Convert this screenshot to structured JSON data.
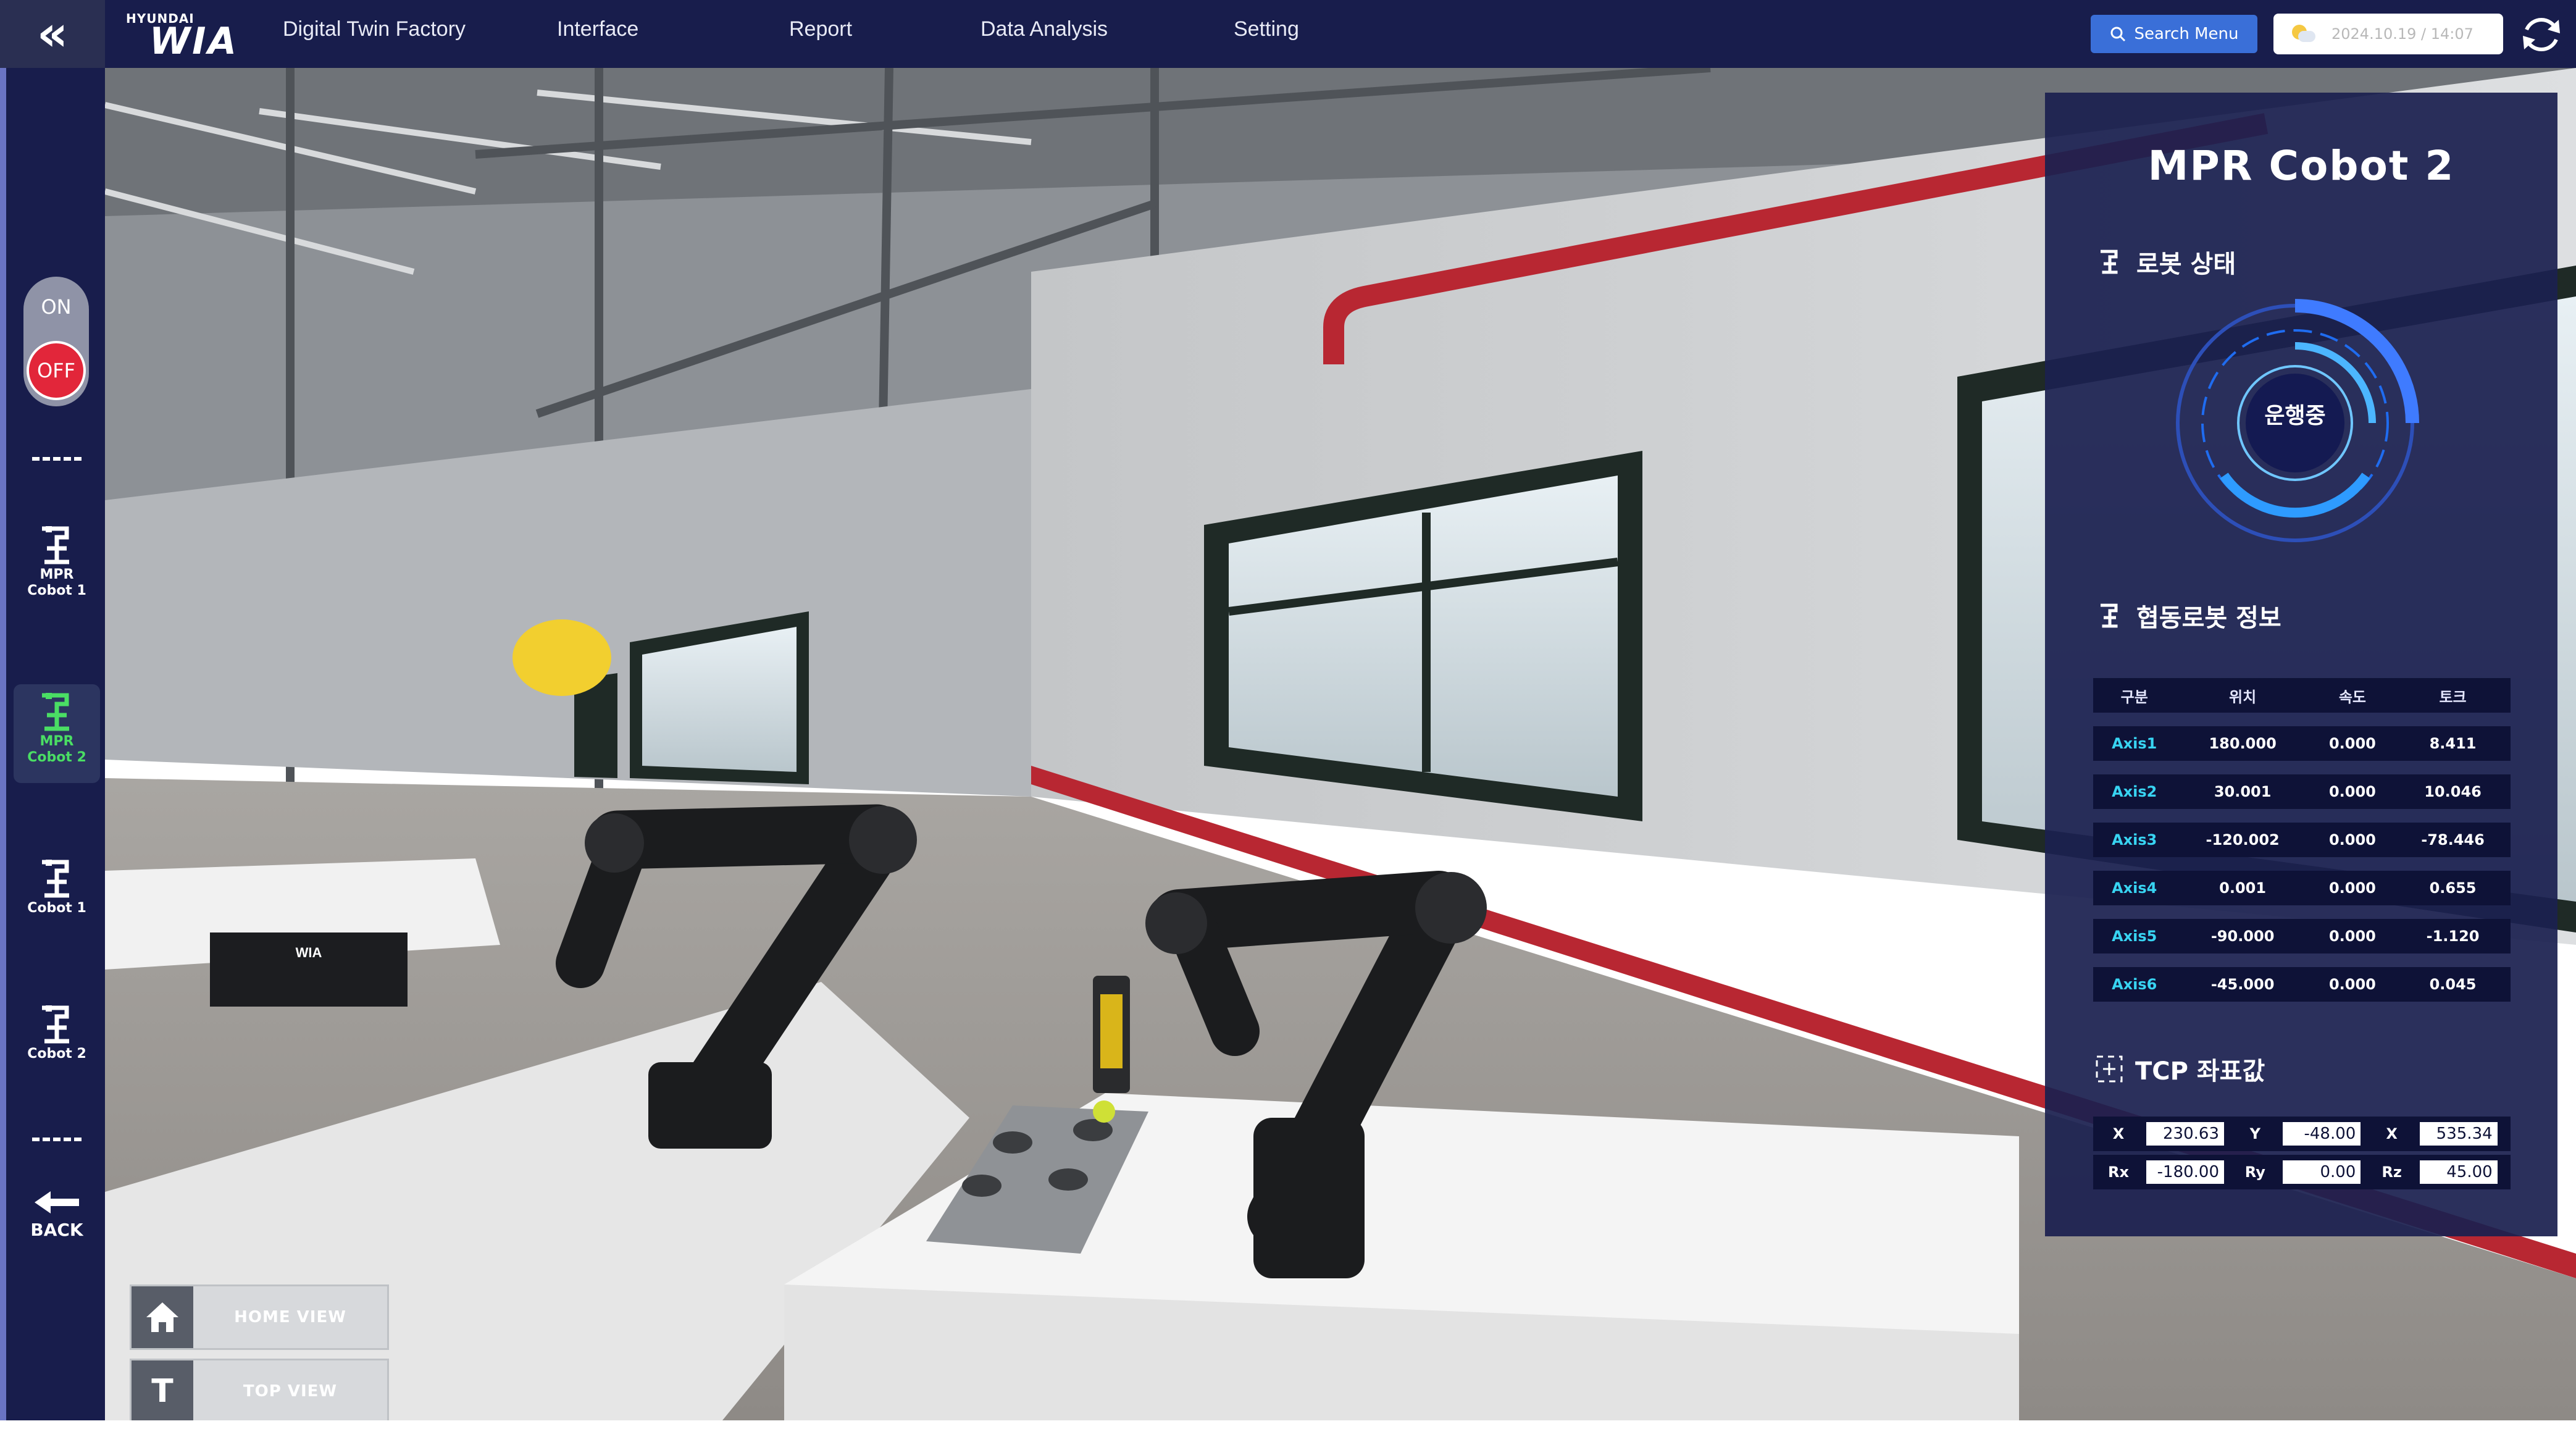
{
  "header": {
    "collapse_glyph": "«",
    "logo_small": "HYUNDAI",
    "logo_big": "WIA",
    "nav": [
      "Digital Twin Factory",
      "Interface",
      "Report",
      "Data Analysis",
      "Setting"
    ],
    "search_label": "Search Menu",
    "datetime": "2024.10.19 / 14:07"
  },
  "sidebar": {
    "power_on_label": "ON",
    "power_off_label": "OFF",
    "items": [
      {
        "line1": "MPR",
        "line2": "Cobot 1"
      },
      {
        "line1": "MPR",
        "line2": "Cobot 2"
      },
      {
        "line1": "",
        "line2": "Cobot 1"
      },
      {
        "line1": "",
        "line2": "Cobot 2"
      }
    ],
    "back_label": "BACK"
  },
  "viewport": {
    "home_view_label": "HOME VIEW",
    "top_view_label": "TOP VIEW",
    "top_view_glyph": "T",
    "crate_logo": "WIA"
  },
  "panel": {
    "title": "MPR Cobot 2",
    "robot_status_title": "로봇 상태",
    "robot_status_value": "운행중",
    "cobot_info_title": "협동로봇 정보",
    "table_headers": [
      "구분",
      "위치",
      "속도",
      "토크"
    ],
    "axes": [
      {
        "name": "Axis1",
        "position": "180.000",
        "speed": "0.000",
        "torque": "8.411"
      },
      {
        "name": "Axis2",
        "position": "30.001",
        "speed": "0.000",
        "torque": "10.046"
      },
      {
        "name": "Axis3",
        "position": "-120.002",
        "speed": "0.000",
        "torque": "-78.446"
      },
      {
        "name": "Axis4",
        "position": "0.001",
        "speed": "0.000",
        "torque": "0.655"
      },
      {
        "name": "Axis5",
        "position": "-90.000",
        "speed": "0.000",
        "torque": "-1.120"
      },
      {
        "name": "Axis6",
        "position": "-45.000",
        "speed": "0.000",
        "torque": "0.045"
      }
    ],
    "tcp_title": "TCP 좌표값",
    "tcp": [
      [
        {
          "k": "X",
          "v": "230.63"
        },
        {
          "k": "Y",
          "v": "-48.00"
        },
        {
          "k": "X",
          "v": "535.34"
        }
      ],
      [
        {
          "k": "Rx",
          "v": "-180.00"
        },
        {
          "k": "Ry",
          "v": "0.00"
        },
        {
          "k": "Rz",
          "v": "45.00"
        }
      ]
    ]
  },
  "colors": {
    "navbar": "#181d4c",
    "panel": "#1b2050",
    "accent_blue": "#3a6fd8",
    "active_green": "#4ade64",
    "axis_cyan": "#38d4f2",
    "off_red": "#e2263a"
  }
}
